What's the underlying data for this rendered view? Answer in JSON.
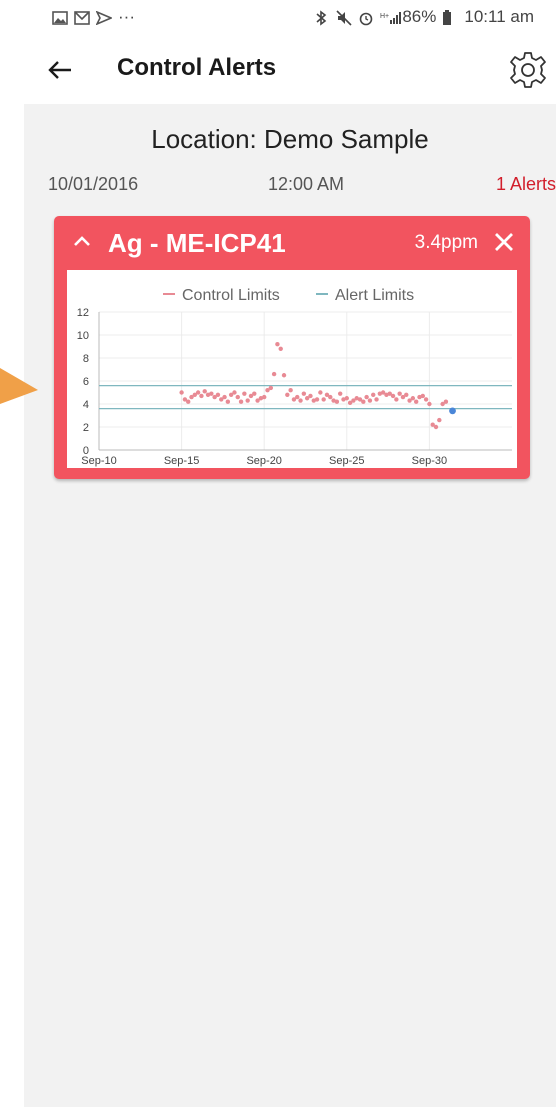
{
  "status_bar": {
    "more": "···",
    "battery": "86%",
    "time": "10:11 am"
  },
  "header": {
    "title": "Control Alerts",
    "back_icon": "back-arrow-icon",
    "settings_icon": "gear-icon"
  },
  "alerts": {
    "location": "Location: Demo Sample",
    "date": "10/01/2016",
    "time": "12:00 AM",
    "count_label": "1 Alerts",
    "card": {
      "analyte": "Ag - ME-ICP41",
      "value": "3.4ppm",
      "color": "#f2545f"
    }
  },
  "chart_data": {
    "type": "scatter",
    "title": "",
    "xlabel": "",
    "ylabel": "",
    "legend": [
      "Control Limits",
      "Alert Limits"
    ],
    "legend_position": "top",
    "grid": true,
    "xlim": [
      10,
      35
    ],
    "ylim": [
      0,
      12
    ],
    "x_ticks": [
      "Sep-10",
      "Sep-15",
      "Sep-20",
      "Sep-25",
      "Sep-30"
    ],
    "x_tick_values": [
      10,
      15,
      20,
      25,
      30
    ],
    "y_ticks": [
      0,
      2,
      4,
      6,
      8,
      10,
      12
    ],
    "control_limits": {
      "color": "#e88a94",
      "values": []
    },
    "alert_limits": {
      "color": "#7fb7bf",
      "values": [
        5.6,
        3.6
      ]
    },
    "series": [
      {
        "color": "#e88a94",
        "x": [
          15.0,
          15.2,
          15.4,
          15.6,
          15.8,
          16.0,
          16.2,
          16.4,
          16.6,
          16.8,
          17.0,
          17.2,
          17.4,
          17.6,
          17.8,
          18.0,
          18.2,
          18.4,
          18.6,
          18.8,
          19.0,
          19.2,
          19.4,
          19.6,
          19.8,
          20.0,
          20.2,
          20.4,
          20.6,
          20.8,
          21.0,
          21.2,
          21.4,
          21.6,
          21.8,
          22.0,
          22.2,
          22.4,
          22.6,
          22.8,
          23.0,
          23.2,
          23.4,
          23.6,
          23.8,
          24.0,
          24.2,
          24.4,
          24.6,
          24.8,
          25.0,
          25.2,
          25.4,
          25.6,
          25.8,
          26.0,
          26.2,
          26.4,
          26.6,
          26.8,
          27.0,
          27.2,
          27.4,
          27.6,
          27.8,
          28.0,
          28.2,
          28.4,
          28.6,
          28.8,
          29.0,
          29.2,
          29.4,
          29.6,
          29.8,
          30.0,
          30.2,
          30.4,
          30.6,
          30.8,
          31.0
        ],
        "y": [
          5.0,
          4.4,
          4.2,
          4.6,
          4.8,
          5.0,
          4.7,
          5.1,
          4.8,
          4.9,
          4.6,
          4.8,
          4.4,
          4.6,
          4.2,
          4.8,
          5.0,
          4.6,
          4.2,
          4.9,
          4.3,
          4.7,
          4.9,
          4.3,
          4.5,
          4.6,
          5.2,
          5.4,
          6.6,
          9.2,
          8.8,
          6.5,
          4.8,
          5.2,
          4.4,
          4.6,
          4.3,
          4.9,
          4.5,
          4.7,
          4.3,
          4.4,
          5.0,
          4.4,
          4.8,
          4.6,
          4.3,
          4.2,
          4.9,
          4.4,
          4.5,
          4.1,
          4.3,
          4.5,
          4.4,
          4.2,
          4.6,
          4.3,
          4.8,
          4.4,
          4.9,
          5.0,
          4.8,
          4.9,
          4.7,
          4.4,
          4.9,
          4.6,
          4.8,
          4.3,
          4.5,
          4.2,
          4.6,
          4.7,
          4.4,
          4.0,
          2.2,
          2.0,
          2.6,
          4.0,
          4.2
        ]
      },
      {
        "color": "#4a86d8",
        "x": [
          31.4
        ],
        "y": [
          3.4
        ]
      }
    ]
  }
}
